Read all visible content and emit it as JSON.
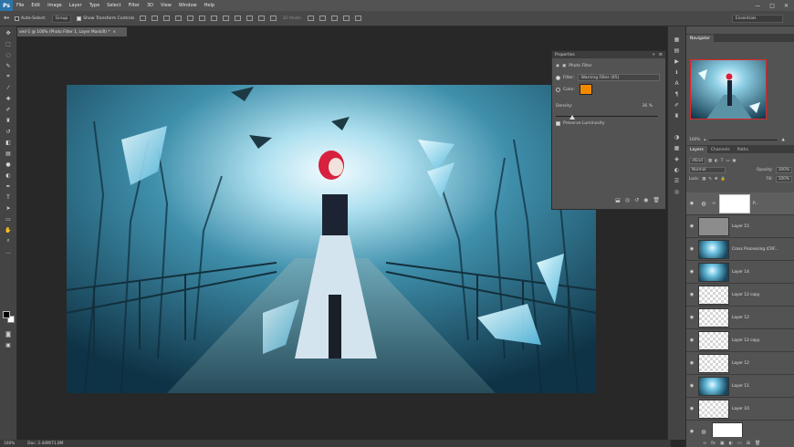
{
  "app": {
    "logo": "Ps"
  },
  "menubar": {
    "items": [
      "File",
      "Edit",
      "Image",
      "Layer",
      "Type",
      "Select",
      "Filter",
      "3D",
      "View",
      "Window",
      "Help"
    ],
    "window_controls": [
      "—",
      "□",
      "✕"
    ]
  },
  "options": {
    "auto_select_label": "Auto-Select:",
    "auto_select_value": "Group",
    "show_transform_label": "Show Transform Controls",
    "mode_3d_label": "3D Mode:",
    "workspace": "Essentials"
  },
  "document": {
    "tab_title": "ved-1 @ 100% (Photo Filter 1, Layer Mask/8) *",
    "tab_close": "×"
  },
  "status": {
    "zoom": "100%",
    "doc_info": "Doc: 2.44M/71.8M"
  },
  "properties": {
    "title": "Properties",
    "panel_name": "Photo Filter",
    "filter_label": "Filter:",
    "filter_value": "Warning Filter (85)",
    "color_label": "Color:",
    "color_hex": "#f28a00",
    "density_label": "Density:",
    "density_value": "36",
    "density_unit": "%",
    "density_level": 0.16,
    "preserve_label": "Preserve Luminosity",
    "preserve_checked": true
  },
  "navigator": {
    "tab": "Navigator",
    "zoom": "100%"
  },
  "layers": {
    "tabs": [
      "Layers",
      "Channels",
      "Paths"
    ],
    "kind_label": "Kind",
    "blend_mode": "Normal",
    "opacity_label": "Opacity:",
    "opacity_value": "100%",
    "lock_label": "Lock:",
    "fill_label": "Fill:",
    "fill_value": "100%",
    "items": [
      {
        "name": "P..."
      },
      {
        "name": "Layer 15"
      },
      {
        "name": "Cross Processing (CRF..."
      },
      {
        "name": "Layer 14"
      },
      {
        "name": "Layer 12 copy"
      },
      {
        "name": "Layer 12"
      },
      {
        "name": "Layer 12 copy"
      },
      {
        "name": "Layer 12"
      },
      {
        "name": "Layer 11"
      },
      {
        "name": "Layer 10"
      }
    ]
  }
}
